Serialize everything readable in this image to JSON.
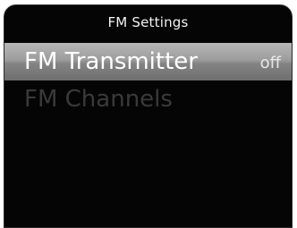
{
  "header": {
    "title": "FM Settings"
  },
  "menu": {
    "items": [
      {
        "label": "FM Transmitter",
        "value": "off"
      },
      {
        "label": "FM Channels"
      }
    ]
  }
}
